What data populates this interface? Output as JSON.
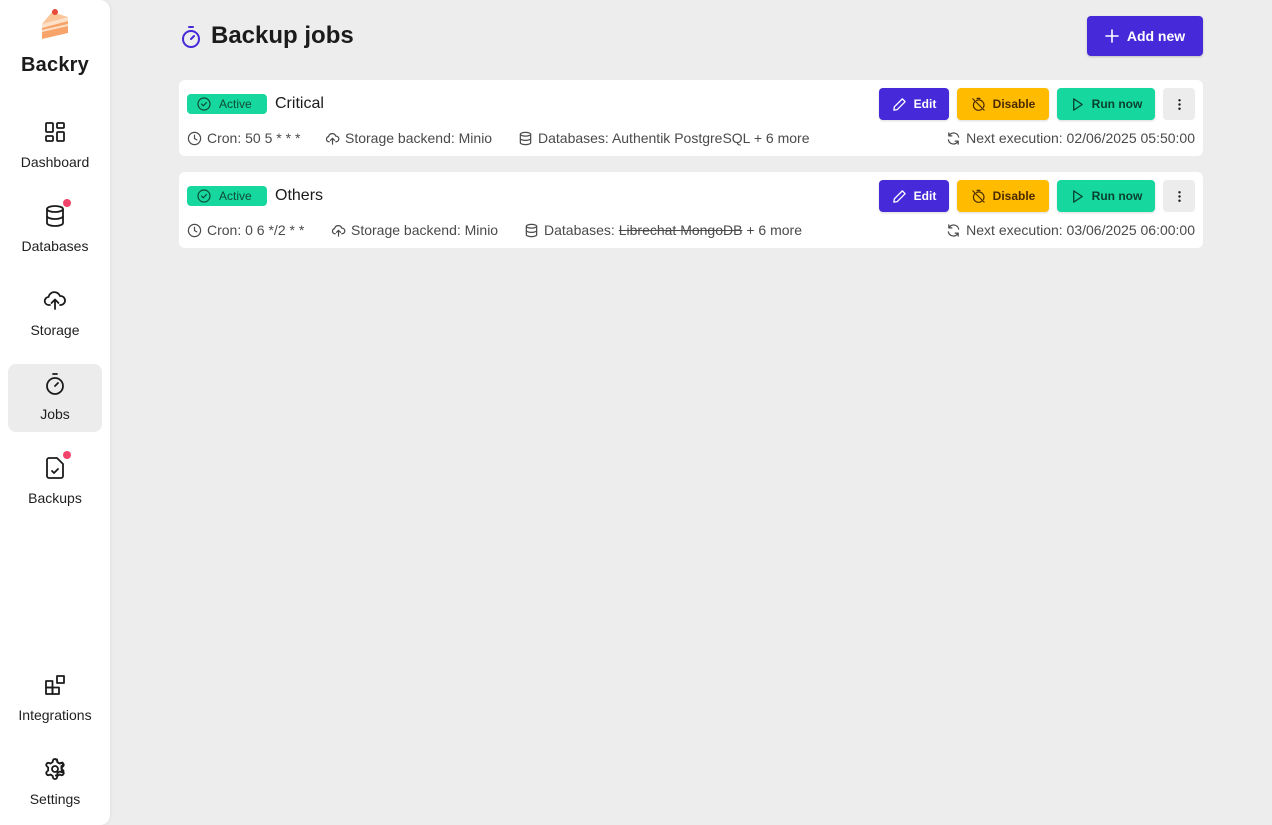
{
  "app": {
    "name": "Backry"
  },
  "colors": {
    "accent": "#4629d9",
    "success": "#16d79d",
    "warning": "#ffbb00",
    "notification": "#f2436a",
    "background": "#ededed"
  },
  "sidebar": {
    "items": [
      {
        "label": "Dashboard",
        "icon": "dashboard-grid-icon",
        "active": false,
        "notification": false
      },
      {
        "label": "Databases",
        "icon": "database-icon",
        "active": false,
        "notification": true
      },
      {
        "label": "Storage",
        "icon": "cloud-upload-icon",
        "active": false,
        "notification": false
      },
      {
        "label": "Jobs",
        "icon": "stopwatch-icon",
        "active": true,
        "notification": false
      },
      {
        "label": "Backups",
        "icon": "file-check-icon",
        "active": false,
        "notification": true
      }
    ],
    "bottom_items": [
      {
        "label": "Integrations",
        "icon": "blocks-icon"
      },
      {
        "label": "Settings",
        "icon": "gear-icon"
      }
    ]
  },
  "header": {
    "title": "Backup jobs",
    "icon": "stopwatch-icon",
    "add_label": "Add new"
  },
  "jobs": [
    {
      "status": "Active",
      "name": "Critical",
      "cron": "Cron: 50 5 * * *",
      "storage": "Storage backend: Minio",
      "databases_prefix": "Databases: ",
      "database_name": "Authentik PostgreSQL",
      "database_struck": false,
      "databases_suffix": " + 6 more",
      "next_execution": "Next execution: 02/06/2025 05:50:00",
      "edit_label": "Edit",
      "disable_label": "Disable",
      "run_label": "Run now"
    },
    {
      "status": "Active",
      "name": "Others",
      "cron": "Cron: 0 6 */2 * *",
      "storage": "Storage backend: Minio",
      "databases_prefix": "Databases: ",
      "database_name": "Librechat MongoDB",
      "database_struck": true,
      "databases_suffix": " + 6 more",
      "next_execution": "Next execution: 03/06/2025 06:00:00",
      "edit_label": "Edit",
      "disable_label": "Disable",
      "run_label": "Run now"
    }
  ]
}
